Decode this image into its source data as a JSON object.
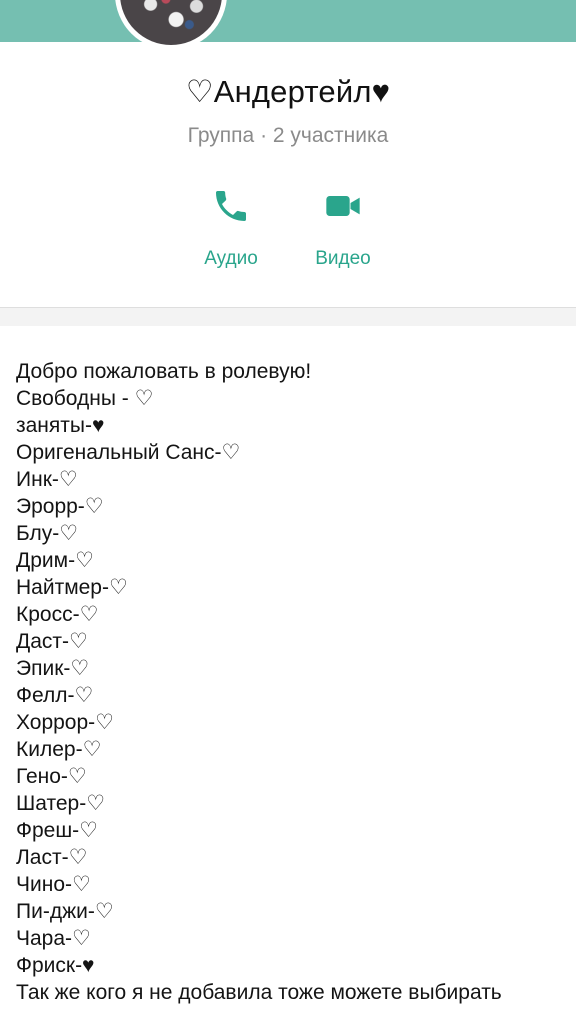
{
  "header": {
    "avatar_icon": "group-avatar",
    "title": "♡Андертейл♥",
    "subtitle": "Группа · 2 участника"
  },
  "actions": {
    "audio": {
      "label": "Аудио",
      "icon": "phone-icon"
    },
    "video": {
      "label": "Видео",
      "icon": "video-camera-icon"
    }
  },
  "colors": {
    "top_bar": "#75bfb1",
    "accent": "#2aa58c"
  },
  "description": {
    "lines": [
      "Добро пожаловать в ролевую!",
      "Свободны - ♡",
      "заняты-♥",
      "Оригенальный Санс-♡",
      "Инк-♡",
      "Эрорр-♡",
      "Блу-♡",
      "Дрим-♡",
      "Найтмер-♡",
      "Кросс-♡",
      "Даст-♡",
      "Эпик-♡",
      "Фелл-♡",
      "Хоррор-♡",
      "Килер-♡",
      "Гено-♡",
      "Шатер-♡",
      "Фреш-♡",
      "Ласт-♡",
      "Чино-♡",
      "Пи-джи-♡",
      "Чара-♡",
      "Фриск-♥",
      "Так же кого я не добавила тоже можете выбирать"
    ]
  }
}
